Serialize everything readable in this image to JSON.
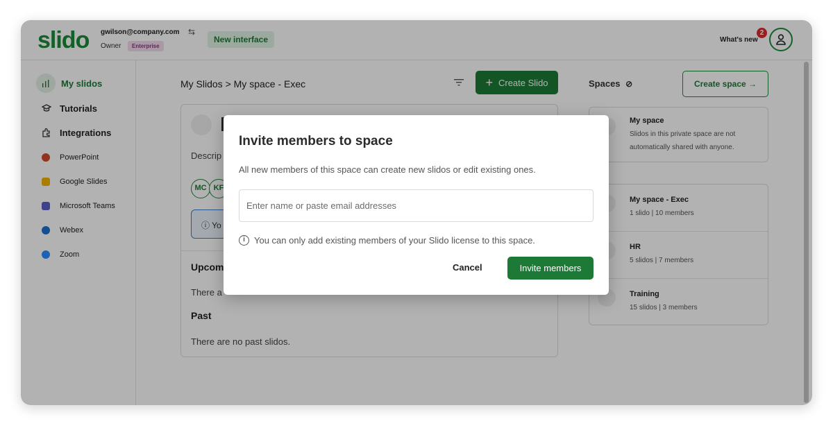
{
  "app": {
    "logo": "slido"
  },
  "account": {
    "email": "gwilson@company.com",
    "role": "Owner",
    "plan_badge": "Enterprise"
  },
  "header": {
    "new_interface": "New interface",
    "whats_new": "What's new",
    "notification_count": "2"
  },
  "icons": {
    "swap": "swap-icon",
    "user": "user-icon",
    "filter": "filter-icon",
    "info": "info-icon",
    "people": "people-icon"
  },
  "sidebar": {
    "items": [
      {
        "label": "My slidos",
        "icon": "bar-chart-icon",
        "active": true
      },
      {
        "label": "Tutorials",
        "icon": "graduation-cap-icon"
      },
      {
        "label": "Integrations",
        "icon": "puzzle-icon"
      },
      {
        "label": "PowerPoint",
        "icon": "powerpoint-icon",
        "color": "#d04a2a"
      },
      {
        "label": "Google Slides",
        "icon": "google-slides-icon",
        "color": "#f4b400"
      },
      {
        "label": "Microsoft Teams",
        "icon": "teams-icon",
        "color": "#5b5fc7"
      },
      {
        "label": "Webex",
        "icon": "webex-icon",
        "color": "#1f6fd0"
      },
      {
        "label": "Zoom",
        "icon": "zoom-icon",
        "color": "#2d8cff"
      }
    ]
  },
  "main": {
    "breadcrumb": "My Slidos > My space - Exec",
    "create_slido": "Create Slido",
    "card": {
      "description_fragment": "Descrip",
      "member_initials": [
        "MC",
        "KF"
      ],
      "info_fragment": "Yo",
      "upcoming_fragment": "Upcom",
      "upcoming_empty_fragment": "There a",
      "past_heading": "Past",
      "past_empty": "There are no past slidos."
    }
  },
  "spaces": {
    "title": "Spaces",
    "create_button": "Create space →",
    "private": {
      "name": "My space",
      "description": "Slidos in this private space are not automatically shared with anyone."
    },
    "list": [
      {
        "name": "My space - Exec",
        "meta": "1 slido | 10 members"
      },
      {
        "name": "HR",
        "meta": "5 slidos | 7 members"
      },
      {
        "name": "Training",
        "meta": "15 slidos | 3 members"
      }
    ]
  },
  "modal": {
    "title": "Invite members to space",
    "description": "All new members of this space can create new slidos or edit existing ones.",
    "input_placeholder": "Enter name or paste email addresses",
    "note": "You can only add existing members of your Slido license to this space.",
    "cancel": "Cancel",
    "invite": "Invite members"
  },
  "colors": {
    "brand_green": "#1c7a36",
    "accent_green": "#1c8a3c",
    "badge_red": "#d72e2e",
    "info_blue": "#3b7fc4"
  }
}
